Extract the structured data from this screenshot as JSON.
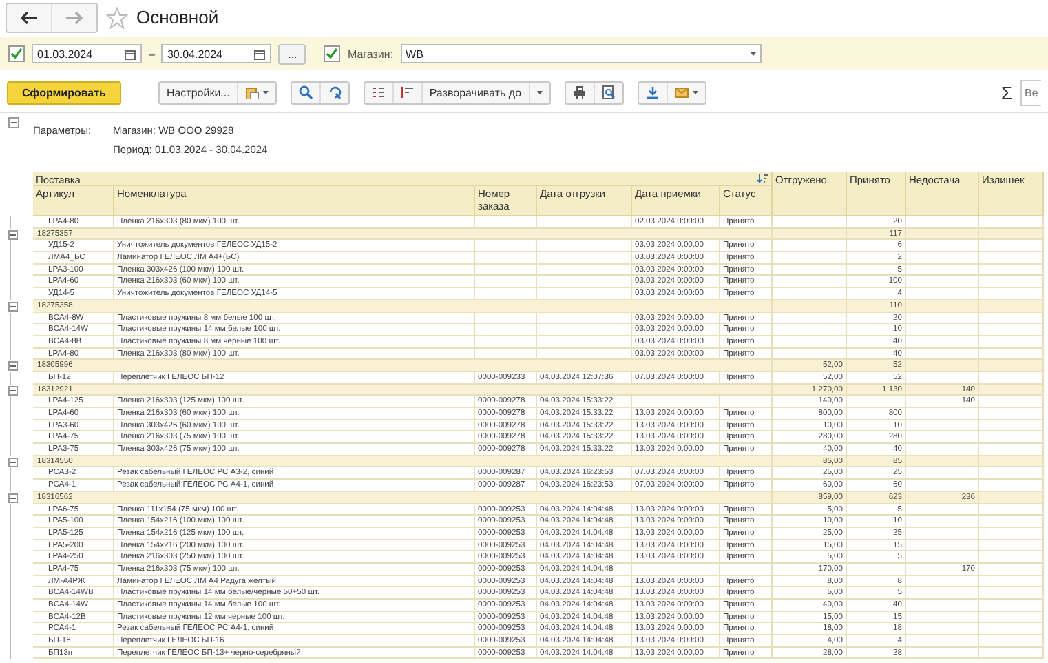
{
  "window": {
    "title": "Основной"
  },
  "filters": {
    "period_enabled": true,
    "date_from": "01.03.2024",
    "dash": "–",
    "date_to": "30.04.2024",
    "more_button": "...",
    "store_enabled": true,
    "store_label": "Магазин:",
    "store_value": "WB"
  },
  "toolbar": {
    "generate": "Сформировать",
    "settings": "Настройки...",
    "expand": "Разворачивать до",
    "sum": "Σ",
    "search_placeholder": "Ве"
  },
  "report": {
    "params_label": "Параметры:",
    "params": [
      "Магазин: WB ООО 29928",
      "Период: 01.03.2024 - 30.04.2024"
    ],
    "header": {
      "group": "Поставка",
      "columns": [
        "Артикул",
        "Номенклатура",
        "Номер заказа",
        "Дата отгрузки",
        "Дата приемки",
        "Статус"
      ],
      "totals": [
        "Отгружено",
        "Принято",
        "Недостача",
        "Излишек"
      ]
    },
    "rows": [
      {
        "kind": "item",
        "article": "LPA4-80",
        "name": "Пленка 216х303 (80 мкм) 100 шт.",
        "received_at": "02.03.2024 0:00:00",
        "status": "Принято",
        "accepted": "20"
      },
      {
        "kind": "group",
        "expanded": true,
        "label": "18275357",
        "accepted": "117"
      },
      {
        "kind": "item",
        "article": "УД15-2",
        "name": "Уничтожитель документов ГЕЛЕОС УД15-2",
        "received_at": "03.03.2024 0:00:00",
        "status": "Принято",
        "accepted": "6"
      },
      {
        "kind": "item",
        "article": "ЛМА4_БС",
        "name": "Ламинатор ГЕЛЕОС ЛМ А4+(БС)",
        "received_at": "03.03.2024 0:00:00",
        "status": "Принято",
        "accepted": "2"
      },
      {
        "kind": "item",
        "article": "LPA3-100",
        "name": "Пленка 303х426 (100 мкм) 100 шт.",
        "received_at": "03.03.2024 0:00:00",
        "status": "Принято",
        "accepted": "5"
      },
      {
        "kind": "item",
        "article": "LPA4-60",
        "name": "Пленка 216х303 (60 мкм) 100 шт.",
        "received_at": "03.03.2024 0:00:00",
        "status": "Принято",
        "accepted": "100"
      },
      {
        "kind": "item",
        "article": "УД14-5",
        "name": "Уничтожитель документов ГЕЛЕОС УД14-5",
        "received_at": "03.03.2024 0:00:00",
        "status": "Принято",
        "accepted": "4"
      },
      {
        "kind": "group",
        "expanded": true,
        "label": "18275358",
        "accepted": "110"
      },
      {
        "kind": "item",
        "article": "BCA4-8W",
        "name": "Пластиковые пружины 8 мм белые 100 шт.",
        "received_at": "03.03.2024 0:00:00",
        "status": "Принято",
        "accepted": "20"
      },
      {
        "kind": "item",
        "article": "BCA4-14W",
        "name": "Пластиковые пружины 14 мм белые 100 шт.",
        "received_at": "03.03.2024 0:00:00",
        "status": "Принято",
        "accepted": "10"
      },
      {
        "kind": "item",
        "article": "BCA4-8B",
        "name": "Пластиковые пружины 8 мм черные 100 шт.",
        "received_at": "03.03.2024 0:00:00",
        "status": "Принято",
        "accepted": "40"
      },
      {
        "kind": "item",
        "article": "LPA4-80",
        "name": "Пленка 216х303 (80 мкм) 100 шт.",
        "received_at": "03.03.2024 0:00:00",
        "status": "Принято",
        "accepted": "40"
      },
      {
        "kind": "group",
        "expanded": true,
        "label": "18305996",
        "shipped": "52,00",
        "accepted": "52"
      },
      {
        "kind": "item",
        "article": "БП-12",
        "name": "Переплетчик ГЕЛЕОС БП-12",
        "order": "0000-009233",
        "shipped_at": "04.03.2024 12:07:36",
        "received_at": "07.03.2024 0:00:00",
        "status": "Принято",
        "shipped": "52,00",
        "accepted": "52"
      },
      {
        "kind": "group",
        "expanded": true,
        "label": "18312921",
        "shipped": "1 270,00",
        "accepted": "1 130",
        "shortage": "140"
      },
      {
        "kind": "item",
        "article": "LPA4-125",
        "name": "Пленка 216х303 (125 мкм) 100 шт.",
        "order": "0000-009278",
        "shipped_at": "04.03.2024 15:33:22",
        "shipped": "140,00",
        "shortage": "140"
      },
      {
        "kind": "item",
        "article": "LPA4-60",
        "name": "Пленка 216х303 (60 мкм) 100 шт.",
        "order": "0000-009278",
        "shipped_at": "04.03.2024 15:33:22",
        "received_at": "13.03.2024 0:00:00",
        "status": "Принято",
        "shipped": "800,00",
        "accepted": "800"
      },
      {
        "kind": "item",
        "article": "LPA3-60",
        "name": "Пленка 303х426 (60 мкм) 100 шт.",
        "order": "0000-009278",
        "shipped_at": "04.03.2024 15:33:22",
        "received_at": "13.03.2024 0:00:00",
        "status": "Принято",
        "shipped": "10,00",
        "accepted": "10"
      },
      {
        "kind": "item",
        "article": "LPA4-75",
        "name": "Пленка 216х303 (75 мкм) 100 шт.",
        "order": "0000-009278",
        "shipped_at": "04.03.2024 15:33:22",
        "received_at": "13.03.2024 0:00:00",
        "status": "Принято",
        "shipped": "280,00",
        "accepted": "280"
      },
      {
        "kind": "item",
        "article": "LPA3-75",
        "name": "Пленка 303х426 (75 мкм) 100 шт.",
        "order": "0000-009278",
        "shipped_at": "04.03.2024 15:33:22",
        "received_at": "13.03.2024 0:00:00",
        "status": "Принято",
        "shipped": "40,00",
        "accepted": "40"
      },
      {
        "kind": "group",
        "expanded": true,
        "label": "18314550",
        "shipped": "85,00",
        "accepted": "85"
      },
      {
        "kind": "item",
        "article": "РСА3-2",
        "name": "Резак сабельный ГЕЛЕОС РС А3-2, синий",
        "order": "0000-009287",
        "shipped_at": "04.03.2024 16:23:53",
        "received_at": "07.03.2024 0:00:00",
        "status": "Принято",
        "shipped": "25,00",
        "accepted": "25"
      },
      {
        "kind": "item",
        "article": "РСА4-1",
        "name": "Резак сабельный ГЕЛЕОС РС А4-1, синий",
        "order": "0000-009287",
        "shipped_at": "04.03.2024 16:23:53",
        "received_at": "07.03.2024 0:00:00",
        "status": "Принято",
        "shipped": "60,00",
        "accepted": "60"
      },
      {
        "kind": "group",
        "expanded": true,
        "label": "18316562",
        "shipped": "859,00",
        "accepted": "623",
        "shortage": "236"
      },
      {
        "kind": "item",
        "article": "LPA6-75",
        "name": "Пленка 111х154 (75 мкм) 100 шт.",
        "order": "0000-009253",
        "shipped_at": "04.03.2024 14:04:48",
        "received_at": "13.03.2024 0:00:00",
        "status": "Принято",
        "shipped": "5,00",
        "accepted": "5"
      },
      {
        "kind": "item",
        "article": "LPA5-100",
        "name": "Пленка 154х216 (100 мкм) 100 шт.",
        "order": "0000-009253",
        "shipped_at": "04.03.2024 14:04:48",
        "received_at": "13.03.2024 0:00:00",
        "status": "Принято",
        "shipped": "10,00",
        "accepted": "10"
      },
      {
        "kind": "item",
        "article": "LPA5-125",
        "name": "Пленка 154х216 (125 мкм) 100 шт.",
        "order": "0000-009253",
        "shipped_at": "04.03.2024 14:04:48",
        "received_at": "13.03.2024 0:00:00",
        "status": "Принято",
        "shipped": "25,00",
        "accepted": "25"
      },
      {
        "kind": "item",
        "article": "LPA5-200",
        "name": "Пленка 154х216 (200 мкм) 100 шт.",
        "order": "0000-009253",
        "shipped_at": "04.03.2024 14:04:48",
        "received_at": "13.03.2024 0:00:00",
        "status": "Принято",
        "shipped": "15,00",
        "accepted": "15"
      },
      {
        "kind": "item",
        "article": "LPA4-250",
        "name": "Пленка 216х303 (250 мкм) 100 шт.",
        "order": "0000-009253",
        "shipped_at": "04.03.2024 14:04:48",
        "received_at": "13.03.2024 0:00:00",
        "status": "Принято",
        "shipped": "5,00",
        "accepted": "5"
      },
      {
        "kind": "item",
        "article": "LPA4-75",
        "name": "Пленка 216х303 (75 мкм) 100 шт.",
        "order": "0000-009253",
        "shipped_at": "04.03.2024 14:04:48",
        "shipped": "170,00",
        "shortage": "170"
      },
      {
        "kind": "item",
        "article": "ЛМ-А4РЖ",
        "name": "Ламинатор ГЕЛЕОС ЛМ А4 Радуга желтый",
        "order": "0000-009253",
        "shipped_at": "04.03.2024 14:04:48",
        "received_at": "13.03.2024 0:00:00",
        "status": "Принято",
        "shipped": "8,00",
        "accepted": "8"
      },
      {
        "kind": "item",
        "article": "BCA4-14WB",
        "name": "Пластиковые пружины 14 мм белые/черные 50+50 шт.",
        "order": "0000-009253",
        "shipped_at": "04.03.2024 14:04:48",
        "received_at": "13.03.2024 0:00:00",
        "status": "Принято",
        "shipped": "5,00",
        "accepted": "5"
      },
      {
        "kind": "item",
        "article": "BCA4-14W",
        "name": "Пластиковые пружины 14 мм белые 100 шт.",
        "order": "0000-009253",
        "shipped_at": "04.03.2024 14:04:48",
        "received_at": "13.03.2024 0:00:00",
        "status": "Принято",
        "shipped": "40,00",
        "accepted": "40"
      },
      {
        "kind": "item",
        "article": "BCA4-12B",
        "name": "Пластиковые пружины 12 мм черные 100 шт.",
        "order": "0000-009253",
        "shipped_at": "04.03.2024 14:04:48",
        "received_at": "13.03.2024 0:00:00",
        "status": "Принято",
        "shipped": "15,00",
        "accepted": "15"
      },
      {
        "kind": "item",
        "article": "РСА4-1",
        "name": "Резак сабельный ГЕЛЕОС РС А4-1, синий",
        "order": "0000-009253",
        "shipped_at": "04.03.2024 14:04:48",
        "received_at": "13.03.2024 0:00:00",
        "status": "Принято",
        "shipped": "18,00",
        "accepted": "18"
      },
      {
        "kind": "item",
        "article": "БП-16",
        "name": "Переплетчик ГЕЛЕОС БП-16",
        "order": "0000-009253",
        "shipped_at": "04.03.2024 14:04:48",
        "received_at": "13.03.2024 0:00:00",
        "status": "Принято",
        "shipped": "4,00",
        "accepted": "4"
      },
      {
        "kind": "item",
        "article": "БП13п",
        "name": "Переплетчик ГЕЛЕОС БП-13+ черно-серебряный",
        "order": "0000-009253",
        "shipped_at": "04.03.2024 14:04:48",
        "received_at": "13.03.2024 0:00:00",
        "status": "Принято",
        "shipped": "28,00",
        "accepted": "28"
      }
    ]
  }
}
